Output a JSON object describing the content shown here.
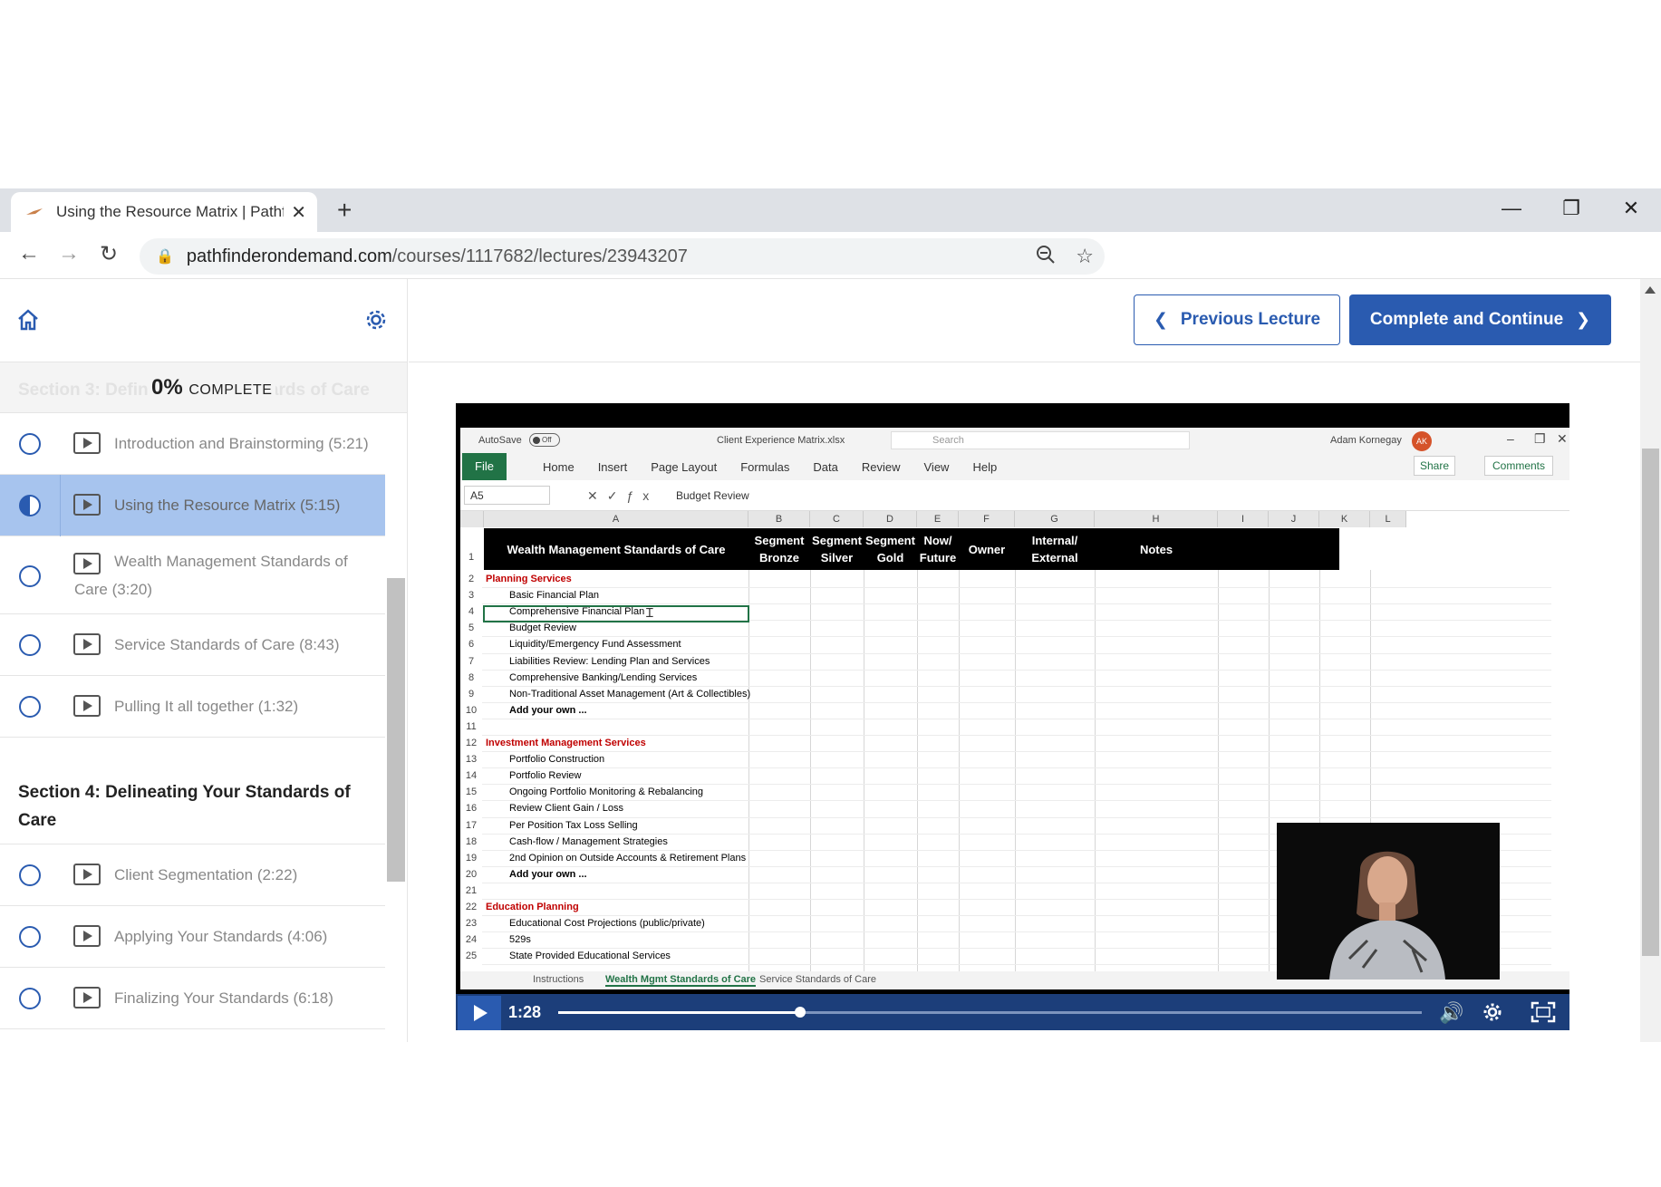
{
  "browser": {
    "tab_title": "Using the Resource Matrix | Pathf",
    "url_host": "pathfinderondemand.com",
    "url_path": "/courses/1117682/lectures/23943207"
  },
  "sidebar": {
    "progress_percent": "0%",
    "progress_label": "COMPLETE",
    "faded_section": "Section 3: Defining Your Standards of Care",
    "section3_lectures": [
      {
        "title": "Introduction and Brainstorming (5:21)",
        "status": "not-started"
      },
      {
        "title": "Using the Resource Matrix (5:15)",
        "status": "in-progress"
      },
      {
        "title": "Wealth Management Standards of Care (3:20)",
        "status": "not-started"
      },
      {
        "title": "Service Standards of Care (8:43)",
        "status": "not-started"
      },
      {
        "title": "Pulling It all together (1:32)",
        "status": "not-started"
      }
    ],
    "section4_title": "Section 4: Delineating Your Standards of Care",
    "section4_lectures": [
      {
        "title": "Client Segmentation (2:22)",
        "status": "not-started"
      },
      {
        "title": "Applying Your Standards (4:06)",
        "status": "not-started"
      },
      {
        "title": "Finalizing Your Standards (6:18)",
        "status": "not-started"
      }
    ]
  },
  "nav": {
    "previous_label": "Previous Lecture",
    "next_label": "Complete and Continue"
  },
  "colors": {
    "brand_blue": "#2a5bb0",
    "active_lecture_bg": "#a7c4ee",
    "excel_green": "#217346",
    "section_red": "#c00000"
  },
  "video": {
    "current_time": "1:28",
    "progress_fraction": 0.28,
    "excel": {
      "autosave": "AutoSave",
      "autosave_state": "Off",
      "filename": "Client Experience Matrix.xlsx",
      "search_placeholder": "Search",
      "user_name": "Adam Kornegay",
      "user_initials": "AK",
      "ribbon_tabs": [
        "File",
        "Home",
        "Insert",
        "Page Layout",
        "Formulas",
        "Data",
        "Review",
        "View",
        "Help"
      ],
      "share": "Share",
      "comments": "Comments",
      "name_box": "A5",
      "formula": "Budget Review",
      "columns": [
        "A",
        "B",
        "C",
        "D",
        "E",
        "F",
        "G",
        "H",
        "I",
        "J",
        "K",
        "L"
      ],
      "header_row": {
        "a": "Wealth Management Standards of Care",
        "b": "Segment Bronze",
        "c": "Segment Silver",
        "d": "Segment Gold",
        "e": "Now/ Future",
        "f": "Owner",
        "g": "Internal/ External",
        "h": "Notes"
      },
      "rows": [
        {
          "n": "2",
          "text": "Planning Services",
          "kind": "section"
        },
        {
          "n": "3",
          "text": "Basic Financial Plan",
          "kind": "item"
        },
        {
          "n": "4",
          "text": "Comprehensive Financial Plan",
          "kind": "item"
        },
        {
          "n": "5",
          "text": "Budget Review",
          "kind": "item"
        },
        {
          "n": "6",
          "text": "Liquidity/Emergency Fund Assessment",
          "kind": "item"
        },
        {
          "n": "7",
          "text": "Liabilities Review: Lending Plan and Services",
          "kind": "item"
        },
        {
          "n": "8",
          "text": "Comprehensive Banking/Lending Services",
          "kind": "item"
        },
        {
          "n": "9",
          "text": "Non-Traditional Asset Management (Art & Collectibles)",
          "kind": "item"
        },
        {
          "n": "10",
          "text": "Add your own ...",
          "kind": "bold"
        },
        {
          "n": "11",
          "text": "",
          "kind": "item"
        },
        {
          "n": "12",
          "text": "Investment Management Services",
          "kind": "section"
        },
        {
          "n": "13",
          "text": "Portfolio Construction",
          "kind": "item"
        },
        {
          "n": "14",
          "text": "Portfolio Review",
          "kind": "item"
        },
        {
          "n": "15",
          "text": "Ongoing Portfolio Monitoring & Rebalancing",
          "kind": "item"
        },
        {
          "n": "16",
          "text": "Review Client Gain / Loss",
          "kind": "item"
        },
        {
          "n": "17",
          "text": "Per Position Tax Loss Selling",
          "kind": "item"
        },
        {
          "n": "18",
          "text": "Cash-flow / Management Strategies",
          "kind": "item"
        },
        {
          "n": "19",
          "text": "2nd Opinion on Outside Accounts & Retirement Plans",
          "kind": "item"
        },
        {
          "n": "20",
          "text": "Add your own ...",
          "kind": "bold"
        },
        {
          "n": "21",
          "text": "",
          "kind": "item"
        },
        {
          "n": "22",
          "text": "Education Planning",
          "kind": "section"
        },
        {
          "n": "23",
          "text": "Educational Cost Projections (public/private)",
          "kind": "item"
        },
        {
          "n": "24",
          "text": "529s",
          "kind": "item"
        },
        {
          "n": "25",
          "text": "State Provided Educational Services",
          "kind": "item"
        }
      ],
      "sheet_tabs": [
        "Instructions",
        "Wealth Mgmt Standards of Care",
        "Service Standards of Care"
      ]
    }
  }
}
